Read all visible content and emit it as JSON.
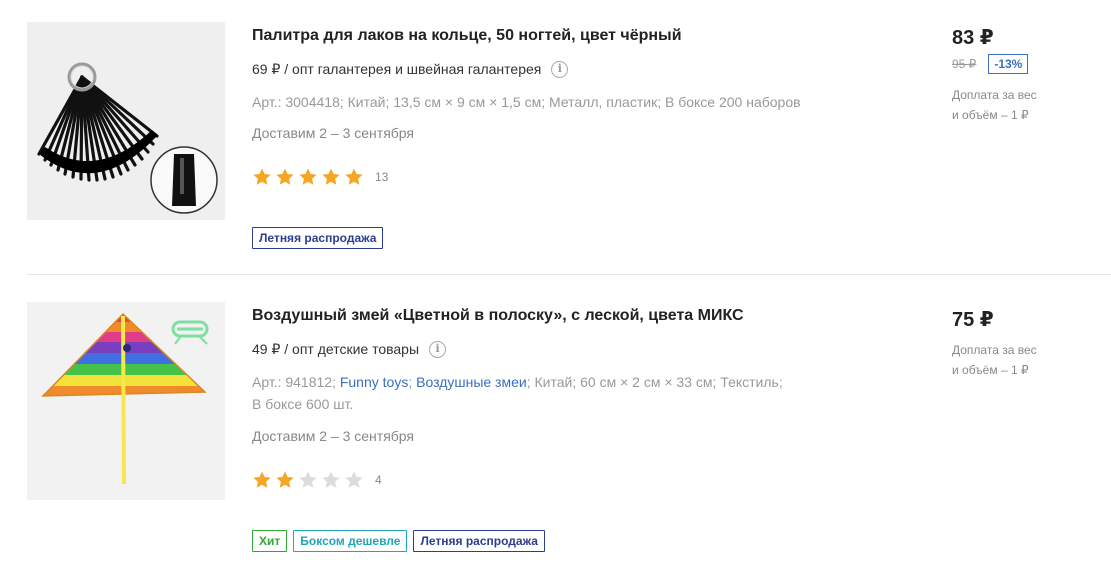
{
  "products": [
    {
      "title": "Палитра для лаков на кольце, 50 ногтей, цвет чёрный",
      "wholesale": "69 ₽ / опт галантерея и швейная галантерея",
      "info_icon": "info-icon",
      "specs": {
        "article": "Арт.: 3004418;",
        "country": "Китай;",
        "size": "13,5 см × 9 см × 1,5 см;",
        "material": "Металл, пластик;",
        "box": "В боксе 200 наборов"
      },
      "delivery": "Доставим 2 – 3 сентября",
      "rating": 5,
      "reviews": "13",
      "badges": [
        "Летняя распродажа"
      ],
      "price": "83 ₽",
      "old_price": "95 ₽",
      "discount": "-13%",
      "extra_fee": "Доплата за вес\nи объём – 1 ₽"
    },
    {
      "title": "Воздушный змей «Цветной в полоску», с леской, цвета МИКС",
      "wholesale": "49 ₽ / опт детские товары",
      "info_icon": "info-icon",
      "specs": {
        "article": "Арт.: 941812;",
        "brand": "Funny toys",
        "category": "Воздушные змеи",
        "country": "Китай;",
        "size": "60 см × 2 см × 33 см;",
        "material": "Текстиль;",
        "box": "В боксе 600 шт."
      },
      "delivery": "Доставим 2 – 3 сентября",
      "rating": 2,
      "reviews": "4",
      "badges": [
        "Хит",
        "Боксом дешевле",
        "Летняя распродажа"
      ],
      "price": "75 ₽",
      "extra_fee": "Доплата за вес\nи объём – 1 ₽"
    }
  ],
  "colors": {
    "star_filled": "#f5a623",
    "star_empty": "#dcdcdc",
    "link": "#3a6fbf",
    "badge_sale": "#2c3e8f",
    "badge_hit": "#2fa834",
    "badge_cheaper": "#1fa6b7"
  }
}
